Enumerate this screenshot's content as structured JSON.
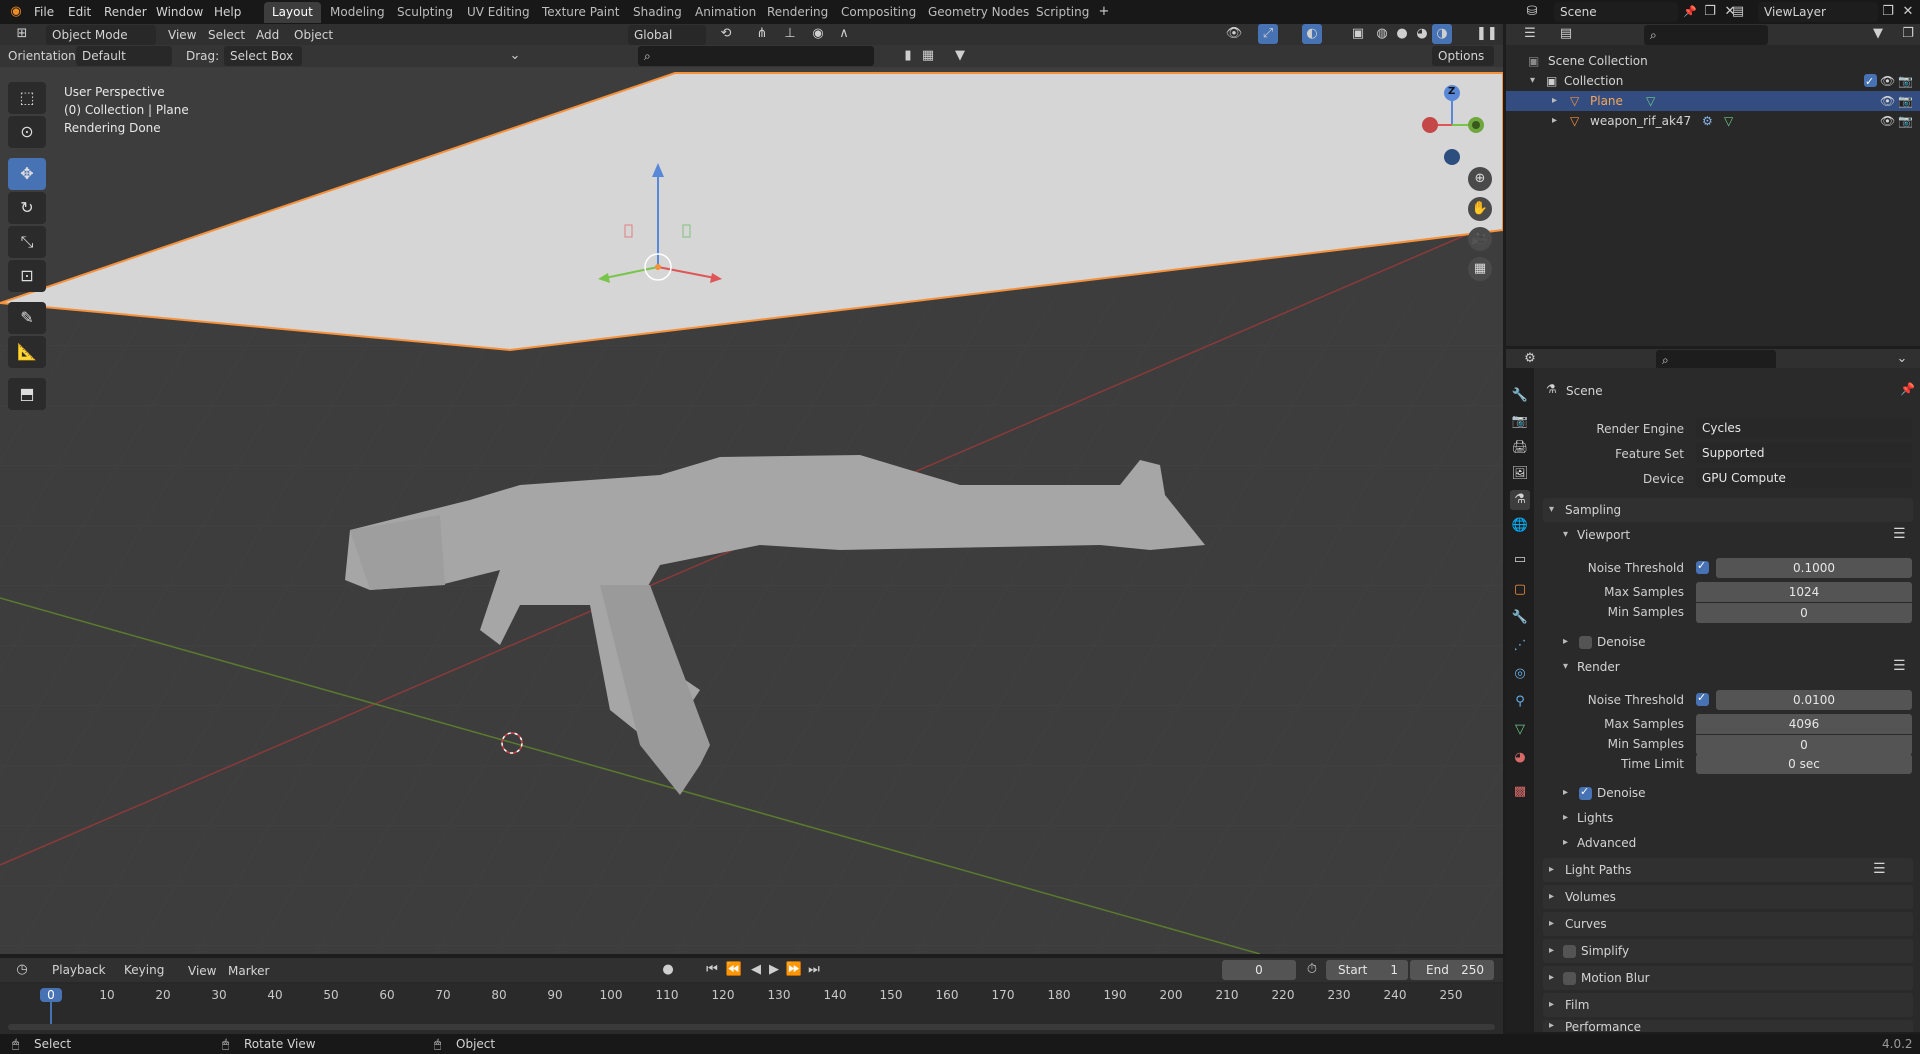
{
  "menu": {
    "file": "File",
    "edit": "Edit",
    "render": "Render",
    "window": "Window",
    "help": "Help"
  },
  "workspaces": [
    "Layout",
    "Modeling",
    "Sculpting",
    "UV Editing",
    "Texture Paint",
    "Shading",
    "Animation",
    "Rendering",
    "Compositing",
    "Geometry Nodes",
    "Scripting"
  ],
  "scene_name": "Scene",
  "view_layer": "ViewLayer",
  "viewport_header": {
    "mode": "Object Mode",
    "view": "View",
    "select": "Select",
    "add": "Add",
    "object": "Object",
    "transform": "Global",
    "options": "Options"
  },
  "tool_settings": {
    "orientation_label": "Orientation:",
    "orientation_value": "Default",
    "drag_label": "Drag:",
    "drag_value": "Select Box"
  },
  "overlay_text": {
    "line1": "User Perspective",
    "line2": "(0) Collection | Plane",
    "line3": "Rendering Done"
  },
  "gizmo": {
    "z": "Z"
  },
  "outliner": {
    "scene_collection": "Scene Collection",
    "collection": "Collection",
    "items": [
      "Plane",
      "weapon_rif_ak47"
    ]
  },
  "properties": {
    "context": "Scene",
    "render_engine_label": "Render Engine",
    "render_engine": "Cycles",
    "feature_set_label": "Feature Set",
    "feature_set": "Supported",
    "device_label": "Device",
    "device": "GPU Compute",
    "sampling": "Sampling",
    "viewport": "Viewport",
    "vp_noise_label": "Noise Threshold",
    "vp_noise": "0.1000",
    "vp_max_label": "Max Samples",
    "vp_max": "1024",
    "vp_min_label": "Min Samples",
    "vp_min": "0",
    "denoise": "Denoise",
    "render": "Render",
    "r_noise_label": "Noise Threshold",
    "r_noise": "0.0100",
    "r_max_label": "Max Samples",
    "r_max": "4096",
    "r_min_label": "Min Samples",
    "r_min": "0",
    "r_time_label": "Time Limit",
    "r_time": "0 sec",
    "r_denoise": "Denoise",
    "lights": "Lights",
    "advanced": "Advanced",
    "panels": [
      "Light Paths",
      "Volumes",
      "Curves",
      "Simplify",
      "Motion Blur",
      "Film",
      "Performance"
    ]
  },
  "timeline": {
    "playback": "Playback",
    "keying": "Keying",
    "view": "View",
    "marker": "Marker",
    "current": "0",
    "start_label": "Start",
    "start": "1",
    "end_label": "End",
    "end": "250",
    "ticks": [
      "0",
      "10",
      "20",
      "30",
      "40",
      "50",
      "60",
      "70",
      "80",
      "90",
      "100",
      "110",
      "120",
      "130",
      "140",
      "150",
      "160",
      "170",
      "180",
      "190",
      "200",
      "210",
      "220",
      "230",
      "240",
      "250"
    ]
  },
  "status": {
    "select": "Select",
    "rotate": "Rotate View",
    "object": "Object",
    "version": "4.0.2"
  },
  "colors": {
    "accent": "#4772b3",
    "selection_orange": "#f5913b",
    "bg": "#3d3d3d"
  }
}
